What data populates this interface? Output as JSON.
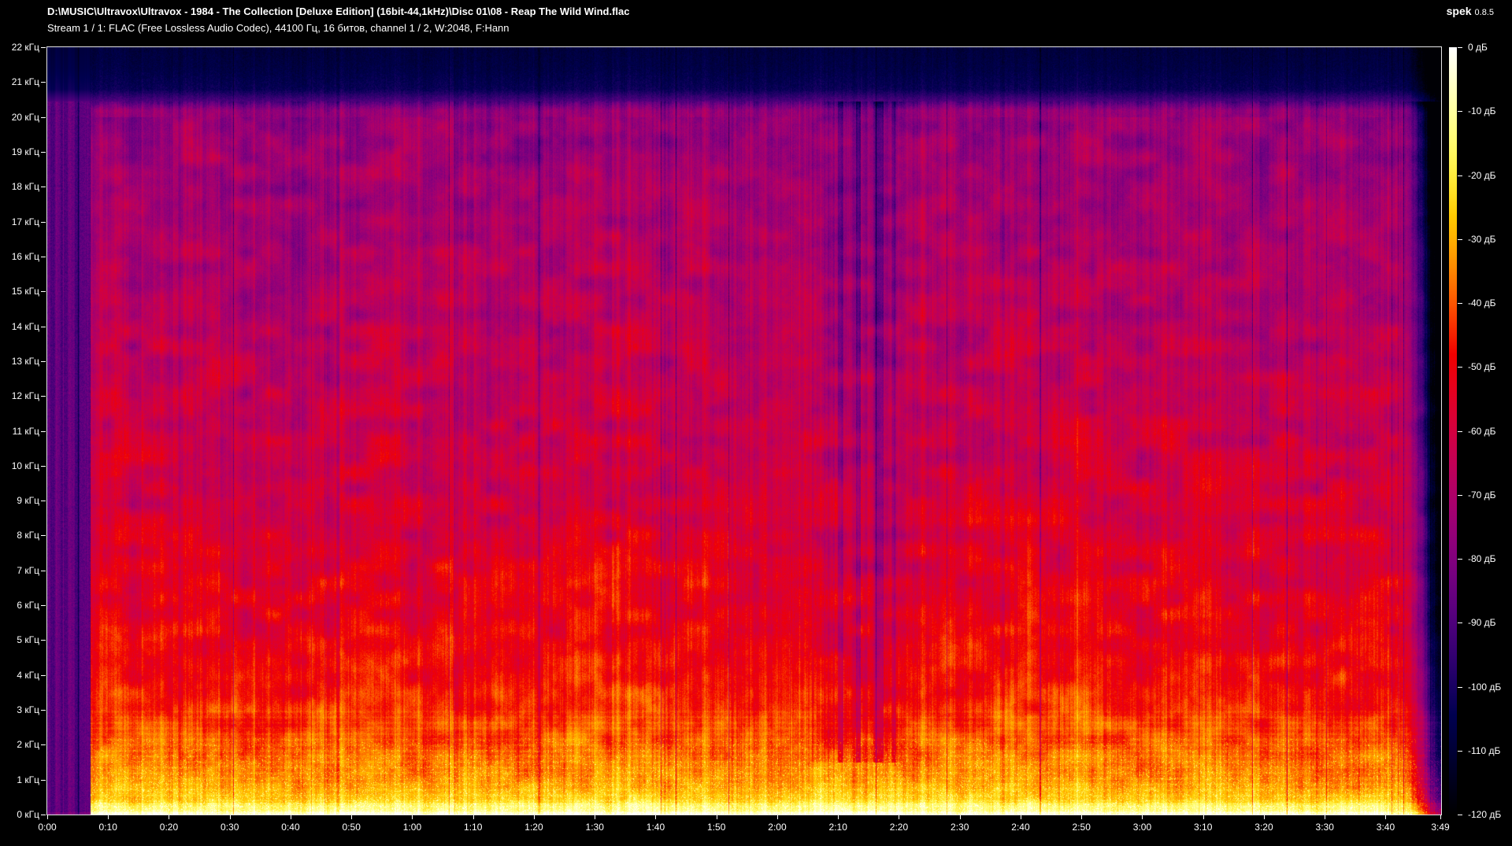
{
  "header": {
    "file_path": "D:\\MUSIC\\Ultravox\\Ultravox - 1984 - The Collection [Deluxe Edition] (16bit-44,1kHz)\\Disc 01\\08 - Reap The Wild Wind.flac",
    "app_name": "spek",
    "app_version": "0.8.5",
    "stream_info": "Stream 1 / 1: FLAC (Free Lossless Audio Codec), 44100 Гц, 16 битов, channel 1 / 2, W:2048, F:Hann"
  },
  "colors": {
    "background": "#000000",
    "text": "#ffffff",
    "plot_frame": "#e6e6e6",
    "palette_name": "spek-sox (black / navy / purple / magenta / red / orange / yellow / white)"
  },
  "chart_data": {
    "type": "heatmap",
    "subtype": "audio-spectrogram",
    "title": "D:\\MUSIC\\Ultravox\\Ultravox - 1984 - The Collection [Deluxe Edition] (16bit-44,1kHz)\\Disc 01\\08 - Reap The Wild Wind.flac",
    "duration_label": "3:49",
    "duration_seconds": 229,
    "x_axis": {
      "unit": "m:ss",
      "tick_interval_seconds": 10,
      "tick_labels": [
        "0:00",
        "0:10",
        "0:20",
        "0:30",
        "0:40",
        "0:50",
        "1:00",
        "1:10",
        "1:20",
        "1:30",
        "1:40",
        "1:50",
        "2:00",
        "2:10",
        "2:20",
        "2:30",
        "2:40",
        "2:50",
        "3:00",
        "3:10",
        "3:20",
        "3:30",
        "3:40",
        "3:49"
      ],
      "tick_seconds": [
        0,
        10,
        20,
        30,
        40,
        50,
        60,
        70,
        80,
        90,
        100,
        110,
        120,
        130,
        140,
        150,
        160,
        170,
        180,
        190,
        200,
        210,
        220,
        229
      ]
    },
    "y_axis": {
      "unit": "кГц",
      "range_khz": [
        0,
        22
      ],
      "tick_labels": [
        "22 кГц",
        "21 кГц",
        "20 кГц",
        "19 кГц",
        "18 кГц",
        "17 кГц",
        "16 кГц",
        "15 кГц",
        "14 кГц",
        "13 кГц",
        "12 кГц",
        "11 кГц",
        "10 кГц",
        "9 кГц",
        "8 кГц",
        "7 кГц",
        "6 кГц",
        "5 кГц",
        "4 кГц",
        "3 кГц",
        "2 кГц",
        "1 кГц",
        "0 кГц"
      ],
      "tick_khz": [
        22,
        21,
        20,
        19,
        18,
        17,
        16,
        15,
        14,
        13,
        12,
        11,
        10,
        9,
        8,
        7,
        6,
        5,
        4,
        3,
        2,
        1,
        0
      ]
    },
    "color_scale": {
      "unit": "дБ",
      "range_db": [
        0,
        -120
      ],
      "tick_labels": [
        "0 дБ",
        "-10 дБ",
        "-20 дБ",
        "-30 дБ",
        "-40 дБ",
        "-50 дБ",
        "-60 дБ",
        "-70 дБ",
        "-80 дБ",
        "-90 дБ",
        "-100 дБ",
        "-110 дБ",
        "-120 дБ"
      ],
      "tick_db": [
        0,
        -10,
        -20,
        -30,
        -40,
        -50,
        -60,
        -70,
        -80,
        -90,
        -100,
        -110,
        -120
      ]
    },
    "features": {
      "lowpass_cutoff_khz": 20.45,
      "quiet_intro_until_seconds": 7.1,
      "quiet_break_seconds": [
        125.5,
        140.5
      ],
      "fadeout_from_seconds": 223,
      "approx_level_db": {
        "bass_0_to_1khz": -24,
        "low_mid_2_to_6khz": -48,
        "mid_8_to_12khz": -59,
        "high_14_to_20khz": -70,
        "above_cutoff": -107
      },
      "spectral_envelope_points_khz_db": [
        [
          0,
          -15
        ],
        [
          0.2,
          -21
        ],
        [
          0.5,
          -27
        ],
        [
          1,
          -34
        ],
        [
          2,
          -40
        ],
        [
          3,
          -44
        ],
        [
          4,
          -48
        ],
        [
          6,
          -53
        ],
        [
          8,
          -57
        ],
        [
          10,
          -60
        ],
        [
          12,
          -63
        ],
        [
          14,
          -66
        ],
        [
          16,
          -69
        ],
        [
          18,
          -72
        ],
        [
          19.5,
          -74
        ],
        [
          20.2,
          -76
        ],
        [
          20.45,
          -90
        ],
        [
          20.8,
          -103
        ],
        [
          21.4,
          -107
        ],
        [
          22,
          -109
        ]
      ]
    }
  }
}
